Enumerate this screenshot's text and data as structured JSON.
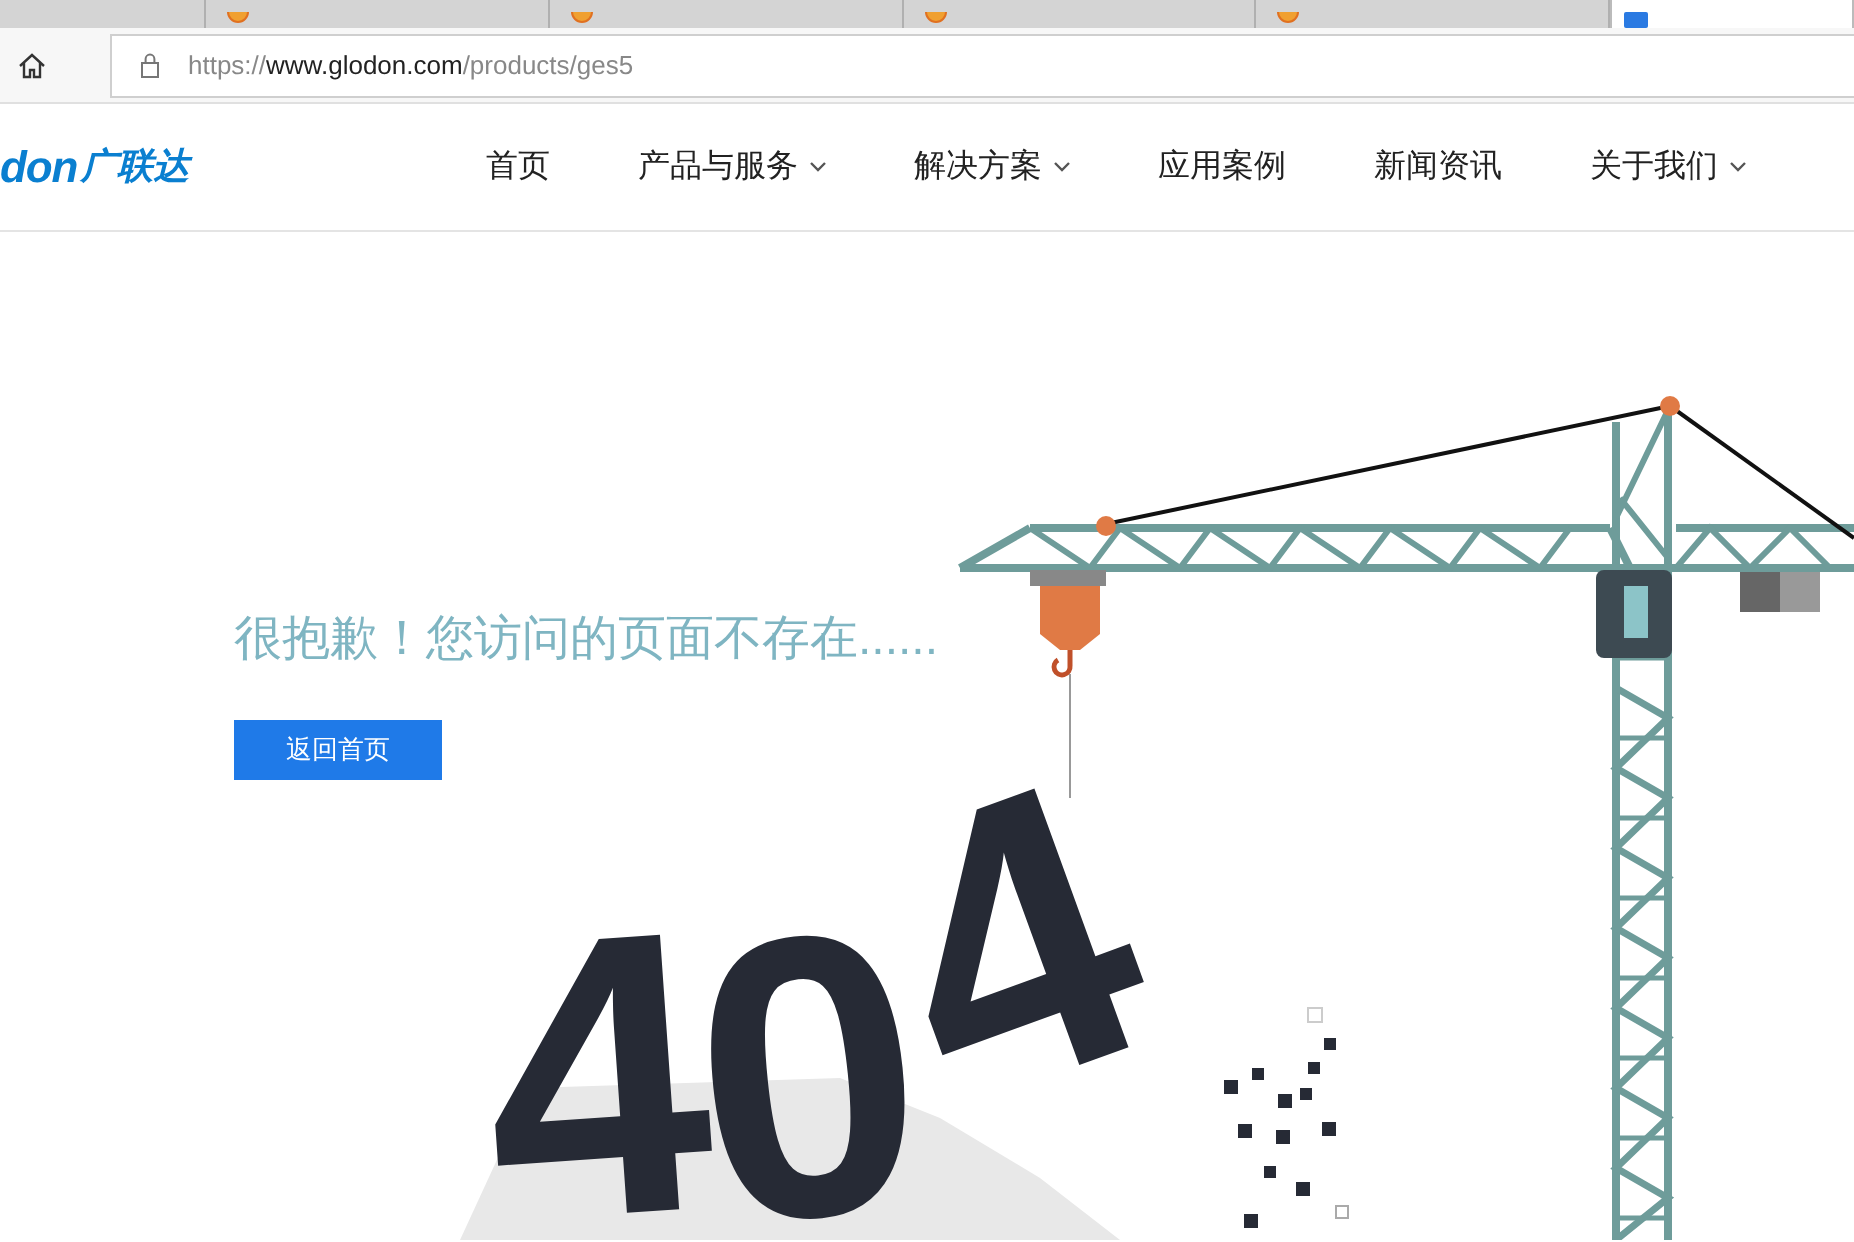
{
  "browser": {
    "tabs": [
      {
        "selected": false,
        "has_icon": false
      },
      {
        "selected": false,
        "has_icon": true
      },
      {
        "selected": false,
        "has_icon": true
      },
      {
        "selected": false,
        "has_icon": true
      },
      {
        "selected": false,
        "has_icon": true
      },
      {
        "selected": true,
        "has_icon": true
      }
    ],
    "address": {
      "scheme": "https://",
      "host": "www.glodon.com",
      "path": "/products/ges5"
    }
  },
  "header": {
    "logo": {
      "latin": "don",
      "chinese": "广联达"
    },
    "nav": [
      {
        "label": "首页",
        "has_dropdown": false
      },
      {
        "label": "产品与服务",
        "has_dropdown": true
      },
      {
        "label": "解决方案",
        "has_dropdown": true
      },
      {
        "label": "应用案例",
        "has_dropdown": false
      },
      {
        "label": "新闻资讯",
        "has_dropdown": false
      },
      {
        "label": "关于我们",
        "has_dropdown": true
      }
    ]
  },
  "error": {
    "message": "很抱歉！您访问的页面不存在......",
    "button": "返回首页",
    "code": "404"
  }
}
